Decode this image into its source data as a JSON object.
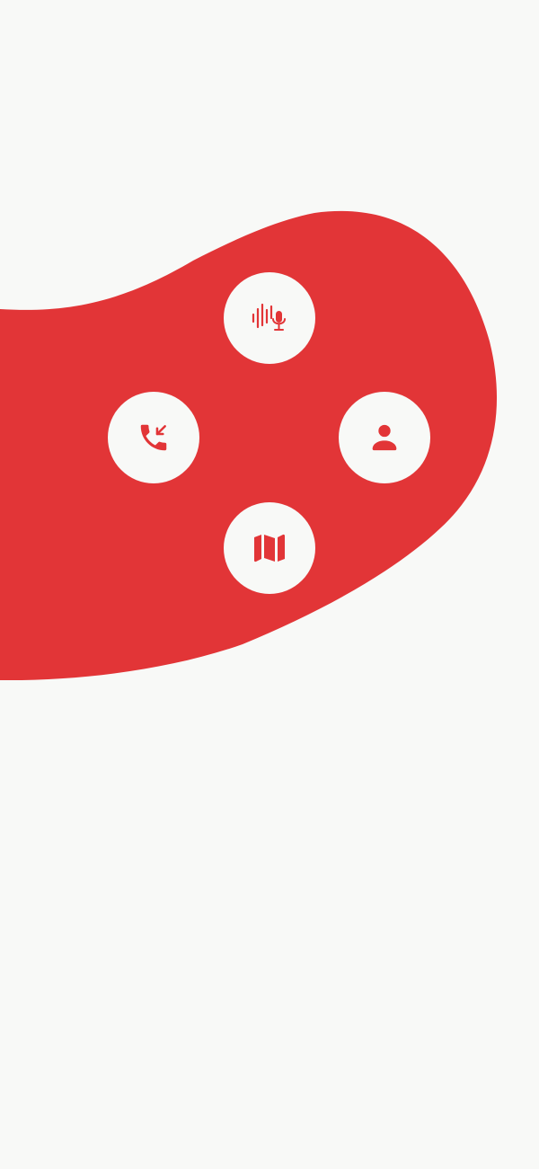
{
  "theme": {
    "background": "#F8F9F7",
    "accent": "#E23537",
    "button_fill": "#F8F9F7",
    "icon_color": "#E23537"
  },
  "actions": [
    {
      "id": "voice",
      "icon": "voice-search-icon"
    },
    {
      "id": "calls",
      "icon": "incoming-call-icon"
    },
    {
      "id": "contact",
      "icon": "person-icon"
    },
    {
      "id": "map",
      "icon": "map-icon"
    }
  ]
}
